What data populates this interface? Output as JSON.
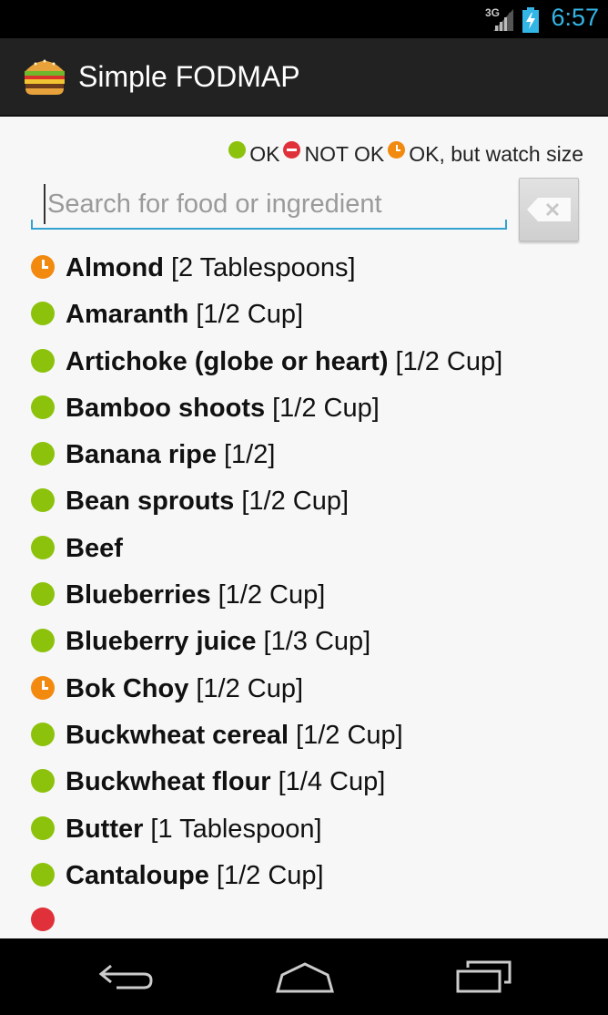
{
  "status_bar": {
    "network": "3G",
    "time": "6:57",
    "icons": [
      "signal-icon",
      "battery-charging-icon"
    ]
  },
  "action_bar": {
    "title": "Simple FODMAP",
    "icon": "burger-icon"
  },
  "legend": {
    "ok_label": "OK",
    "not_ok_label": "NOT OK",
    "watch_label": "OK, but watch size"
  },
  "search": {
    "placeholder": "Search for food or ingredient",
    "value": "",
    "clear_icon": "backspace-icon"
  },
  "foods": [
    {
      "name": "Almond",
      "portion": "[2 Tablespoons]",
      "status": "watch"
    },
    {
      "name": "Amaranth",
      "portion": "[1/2 Cup]",
      "status": "ok"
    },
    {
      "name": "Artichoke (globe or heart)",
      "portion": "[1/2 Cup]",
      "status": "ok"
    },
    {
      "name": "Bamboo shoots",
      "portion": "[1/2 Cup]",
      "status": "ok"
    },
    {
      "name": "Banana ripe",
      "portion": "[1/2]",
      "status": "ok"
    },
    {
      "name": "Bean sprouts",
      "portion": "[1/2 Cup]",
      "status": "ok"
    },
    {
      "name": "Beef",
      "portion": "",
      "status": "ok"
    },
    {
      "name": "Blueberries",
      "portion": "[1/2 Cup]",
      "status": "ok"
    },
    {
      "name": "Blueberry juice",
      "portion": "[1/3 Cup]",
      "status": "ok"
    },
    {
      "name": "Bok Choy",
      "portion": "[1/2 Cup]",
      "status": "watch"
    },
    {
      "name": "Buckwheat cereal",
      "portion": "[1/2 Cup]",
      "status": "ok"
    },
    {
      "name": "Buckwheat flour",
      "portion": "[1/4 Cup]",
      "status": "ok"
    },
    {
      "name": "Butter",
      "portion": "[1 Tablespoon]",
      "status": "ok"
    },
    {
      "name": "Cantaloupe",
      "portion": "[1/2 Cup]",
      "status": "ok"
    }
  ],
  "colors": {
    "ok": "#8cc20b",
    "not_ok": "#e0313a",
    "watch": "#f28a10",
    "accent": "#33b5e5"
  },
  "nav": {
    "icons": [
      "back-icon",
      "home-icon",
      "recent-apps-icon"
    ]
  }
}
